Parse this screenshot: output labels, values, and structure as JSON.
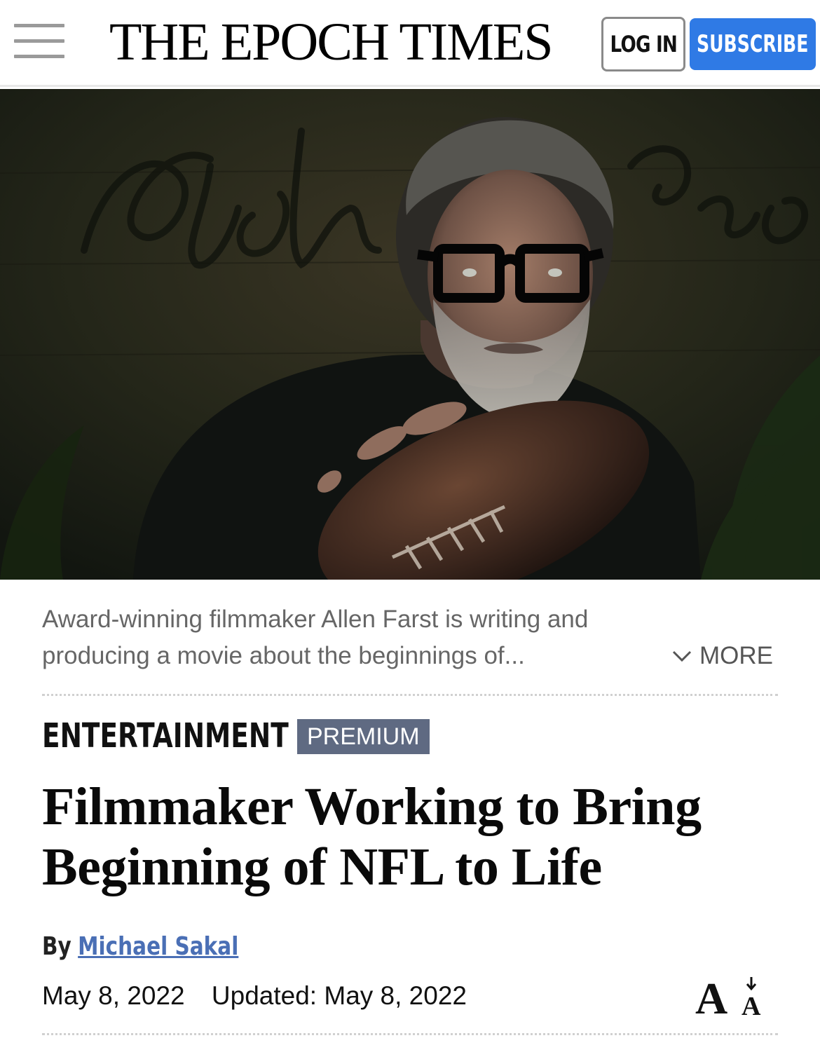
{
  "header": {
    "logo": "THE EPOCH TIMES",
    "login_label": "LOG IN",
    "subscribe_label": "SUBSCRIBE",
    "menu_icon": "hamburger-menu-icon",
    "subscribe_color": "#2f7ae5"
  },
  "hero": {
    "caption": "Award-winning filmmaker Allen Farst is writing and producing a movie about the beginnings of...",
    "more_label": "MORE",
    "more_icon": "chevron-down-icon"
  },
  "article": {
    "category": "ENTERTAINMENT",
    "badge": "PREMIUM",
    "badge_color": "#5f6a82",
    "title": "Filmmaker Working to Bring Beginning of NFL to Life",
    "byline_prefix": "By",
    "author": "Michael Sakal",
    "author_color": "#4a6fb5",
    "published": "May 8, 2022",
    "updated": "Updated: May 8, 2022",
    "font_size_icon": "font-size-icon"
  }
}
